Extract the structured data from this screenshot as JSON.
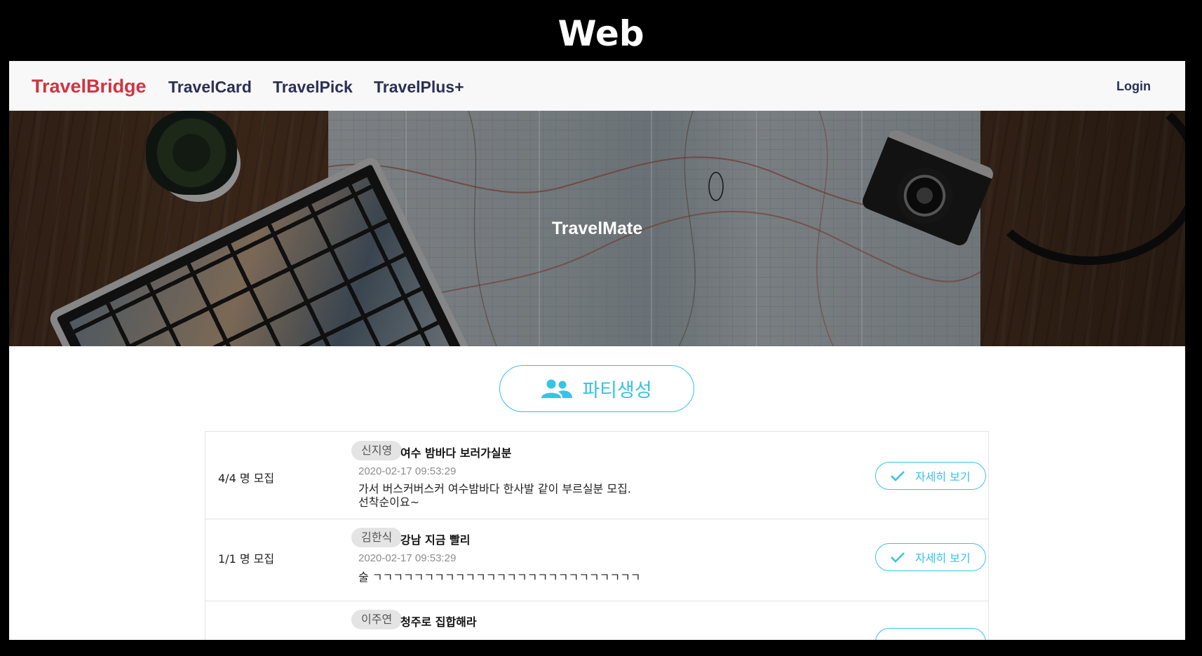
{
  "caption": "Web",
  "navbar": {
    "brand": "TravelBridge",
    "links": [
      "TravelCard",
      "TravelPick",
      "TravelPlus+"
    ],
    "login": "Login"
  },
  "hero": {
    "title": "TravelMate"
  },
  "party_button": {
    "label": "파티생성",
    "icon": "people-icon"
  },
  "posts": [
    {
      "count": "4/4 명 모집",
      "author": "신지영",
      "title": "여수 밤바다 보러가실분",
      "date": "2020-02-17 09:53:29",
      "body": "가서 버스커버스커 여수밤바다 한사발 같이 부르실분 모집.\n선착순이요~",
      "detail_label": "자세히 보기"
    },
    {
      "count": "1/1 명 모집",
      "author": "김한식",
      "title": "강남 지금 빨리",
      "date": "2020-02-17 09:53:29",
      "body": "술 ㄱㄱㄱㄱㄱㄱㄱㄱㄱㄱㄱㄱㄱㄱㄱㄱㄱㄱㄱㄱㄱㄱㄱㄱㄱㄱ",
      "detail_label": "자세히 보기"
    },
    {
      "author": "이주연",
      "title": "청주로 집합해라"
    }
  ],
  "colors": {
    "brand": "#d0343f",
    "nav": "#2a2f55",
    "accent": "#35c3e6"
  }
}
